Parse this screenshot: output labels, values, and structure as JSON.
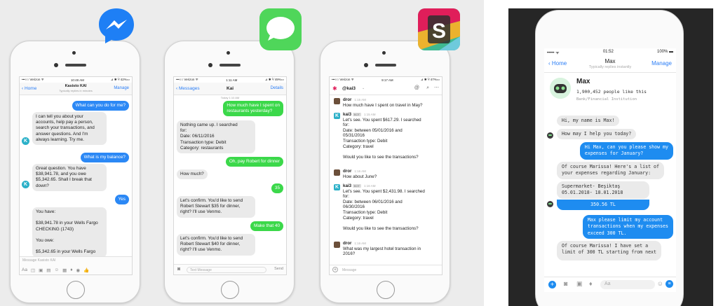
{
  "messenger": {
    "status": {
      "carrier": "•••○○ Verizon ᯤ",
      "time": "10:48 AM",
      "battery": "⊿ ✱ ⅟ 42%▭"
    },
    "nav": {
      "back": "Home",
      "title": "Kasisto KAI",
      "subtitle": "Typically replies in minutes",
      "right": "Manage"
    },
    "messages": [
      {
        "dir": "out",
        "text": "What can you do for me?"
      },
      {
        "dir": "in",
        "text": "I can tell you about your\naccounts, help pay a person,\nsearch your transactions, and\nanswer questions. And I'm\nalways learning. Try me."
      },
      {
        "dir": "out",
        "text": "What is my balance?"
      },
      {
        "dir": "in",
        "text": "Great question. You have\n$38,941.78, and you owe\n$5,342.65. Shall I break that\ndown?"
      },
      {
        "dir": "out",
        "text": "Yes"
      },
      {
        "dir": "in",
        "text": "You have:\n\n$38,941.78 in your Wells Fargo\nCHECKING (1743)\n\nYou owe:\n\n$5,342.65 in your Wells Fargo"
      }
    ],
    "input_placeholder": "Message Kasisto KAI"
  },
  "imessage": {
    "status": {
      "carrier": "•••○○ Verizon ᯤ",
      "time": "1:11 AM",
      "battery": "⊿ ✱ ⅟ 49%▭"
    },
    "nav": {
      "back": "Messages",
      "title": "Kai",
      "right": "Details"
    },
    "timestamp": "Today 1:10 AM",
    "messages": [
      {
        "dir": "out",
        "text": "How much have I spent on\nrestaurants yesterday?"
      },
      {
        "dir": "in",
        "text": "Nothing came up. I searched\nfor:\nDate: 06/11/2016\nTransaction type: Debit\nCategory: restaurants"
      },
      {
        "dir": "out",
        "text": "Oh, pay Robert for dinner"
      },
      {
        "dir": "in",
        "text": "How much?"
      },
      {
        "dir": "out",
        "text": "35"
      },
      {
        "dir": "in",
        "text": "Let's confirm. You'd like to send\nRobert Stewart $35 for dinner,\nright? I'll use Venmo."
      },
      {
        "dir": "out",
        "text": "Make that 40"
      },
      {
        "dir": "in",
        "text": "Let's confirm. You'd like to send\nRobert Stewart $40 for dinner,\nright? I'll use Venmo."
      }
    ],
    "input_placeholder": "Text Message",
    "send_label": "Send"
  },
  "slack": {
    "status": {
      "carrier": "•••○○ Verizon ᯤ",
      "time": "9:17 AM",
      "battery": "⊿ ✱ ⅟ 47%▭"
    },
    "channel": "@kai3",
    "messages": [
      {
        "user": "dror",
        "time": "1:15 AM",
        "bot": false,
        "text": "How much have I spent on travel in May?"
      },
      {
        "user": "kai3",
        "time": "1:15 AM",
        "bot": true,
        "text": "Let's see. You spent $617.29. I searched\nfor:\nDate: between 05/01/2016 and\n05/31/2016\nTransaction type: Debit\nCategory: travel\n\nWould you like to see the transactions?"
      },
      {
        "user": "dror",
        "time": "1:16 AM",
        "bot": false,
        "text": "How about June?"
      },
      {
        "user": "kai3",
        "time": "1:16 AM",
        "bot": true,
        "text": "Let's see. You spent $2,431.98. I searched\nfor:\nDate: between 06/01/2016 and\n06/30/2016\nTransaction type: Debit\nCategory: travel\n\nWould you like to see the transactions?"
      },
      {
        "user": "dror",
        "time": "1:16 AM",
        "bot": false,
        "text": "What was my largest hotel transaction in\n2016?"
      }
    ],
    "bot_tag": "BOT",
    "input_placeholder": "Message"
  },
  "max": {
    "status": {
      "signal": "•••••  ᯤ",
      "time": "01:52",
      "battery": "100% ▬"
    },
    "nav": {
      "back": "Home",
      "title": "Max",
      "subtitle": "Typically replies instantly",
      "right": "Manage"
    },
    "profile": {
      "name": "Max",
      "likes": "1,900,452 people like this",
      "category": "Bank/Financial Institution"
    },
    "messages": [
      {
        "dir": "in",
        "text": "Hi, my name is Max!"
      },
      {
        "dir": "in",
        "text": "How may I help you today?"
      },
      {
        "dir": "out",
        "text": "Hi Max, can you please show my\nexpenses for January?"
      },
      {
        "dir": "in",
        "text": "Of course Marissa! Here's a list of\nyour expenses regarding January:"
      },
      {
        "dir": "in",
        "text": "Supermarket- Beşiktaş\n05.01.2018- 18.01.2018"
      },
      {
        "dir": "card",
        "text": "350.56 TL"
      },
      {
        "dir": "out",
        "text": "Max please limit my account\ntransactions when my expenses\nexceed 300 TL."
      },
      {
        "dir": "in",
        "text": "Of course Marissa! I have set a\nlimit of 300 TL starting from next"
      }
    ],
    "input_placeholder": "Aa"
  },
  "colors": {
    "messenger_blue": "#2b88f5",
    "imessage_green": "#3bd84a",
    "slack_yellow": "#ecb22e",
    "slack_red": "#e01e5a"
  }
}
